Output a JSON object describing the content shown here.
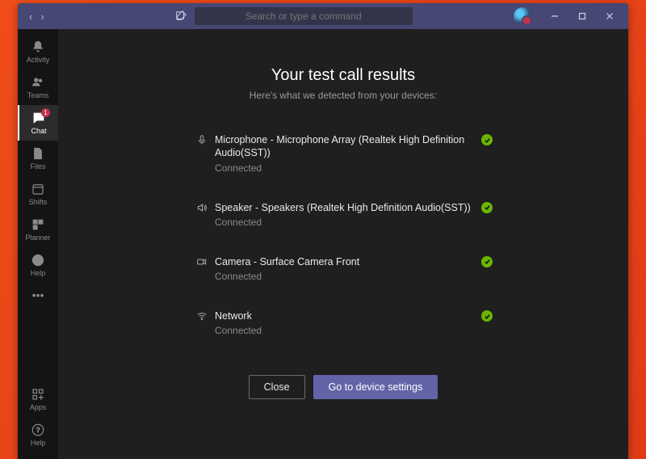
{
  "colors": {
    "titlebar": "#464775",
    "sidebar": "#141414",
    "panel": "#1f1f1f",
    "primary_button": "#6264a7",
    "success": "#6bb700",
    "badge": "#c4314b",
    "desktop": "#e8471f"
  },
  "titlebar": {
    "search_placeholder": "Search or type a command"
  },
  "sidebar": {
    "items": [
      {
        "icon": "bell-icon",
        "label": "Activity",
        "selected": false,
        "badge": null
      },
      {
        "icon": "people-icon",
        "label": "Teams",
        "selected": false,
        "badge": null
      },
      {
        "icon": "chat-icon",
        "label": "Chat",
        "selected": true,
        "badge": "1"
      },
      {
        "icon": "file-icon",
        "label": "Files",
        "selected": false,
        "badge": null
      },
      {
        "icon": "shifts-icon",
        "label": "Shifts",
        "selected": false,
        "badge": null
      },
      {
        "icon": "planner-icon",
        "label": "Planner",
        "selected": false,
        "badge": null
      },
      {
        "icon": "help-icon",
        "label": "Help",
        "selected": false,
        "badge": null
      }
    ],
    "bottom": [
      {
        "icon": "apps-icon",
        "label": "Apps"
      },
      {
        "icon": "help-icon",
        "label": "Help"
      }
    ]
  },
  "results": {
    "title": "Your test call results",
    "subtitle": "Here's what we detected from your devices:",
    "devices": [
      {
        "icon": "microphone-icon",
        "name": "Microphone - Microphone Array (Realtek High Definition Audio(SST))",
        "status": "Connected",
        "ok": true
      },
      {
        "icon": "speaker-icon",
        "name": "Speaker - Speakers (Realtek High Definition Audio(SST))",
        "status": "Connected",
        "ok": true
      },
      {
        "icon": "camera-icon",
        "name": "Camera - Surface Camera Front",
        "status": "Connected",
        "ok": true
      },
      {
        "icon": "network-icon",
        "name": "Network",
        "status": "Connected",
        "ok": true
      }
    ],
    "buttons": {
      "close": "Close",
      "settings": "Go to device settings"
    }
  }
}
